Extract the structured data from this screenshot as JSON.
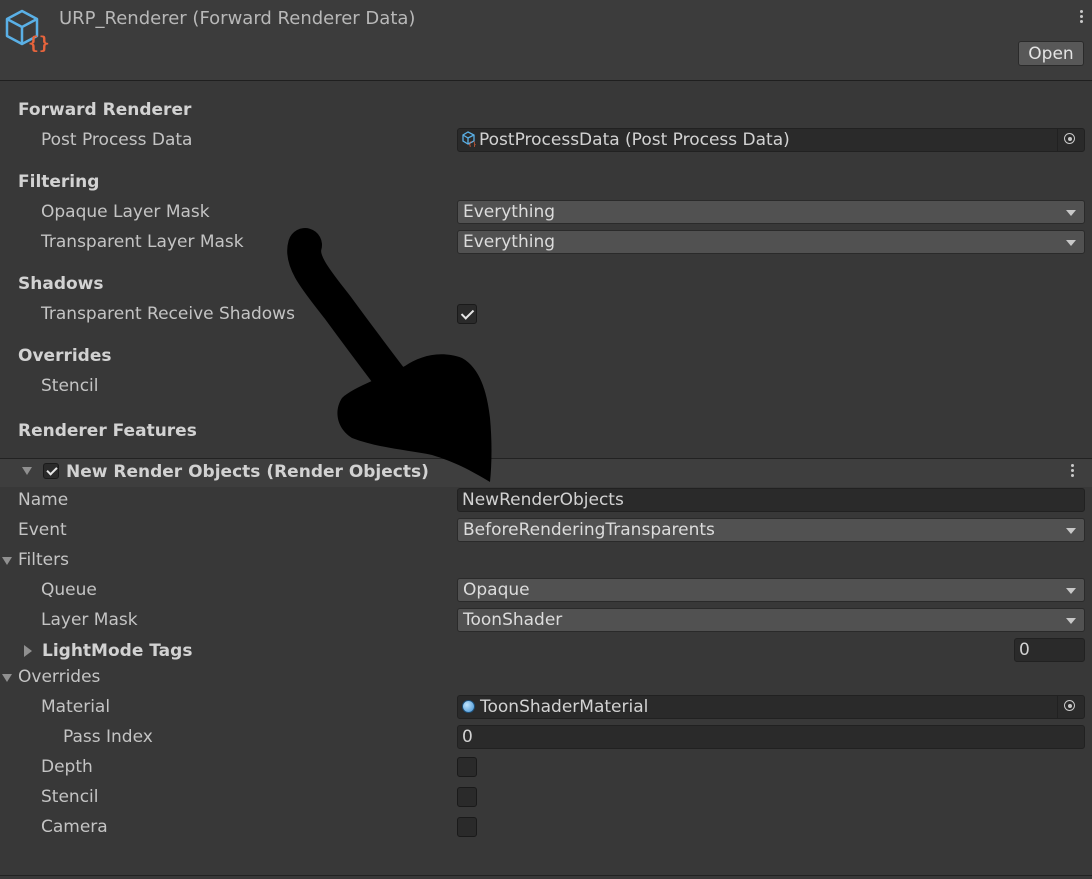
{
  "header": {
    "title": "URP_Renderer (Forward Renderer Data)",
    "open_label": "Open",
    "icon": "script-asset-icon"
  },
  "sections": {
    "forward_renderer": "Forward Renderer",
    "filtering": "Filtering",
    "shadows": "Shadows",
    "overrides": "Overrides",
    "renderer_features": "Renderer Features"
  },
  "fields": {
    "post_process_label": "Post Process Data",
    "post_process_value": "PostProcessData (Post Process Data)",
    "opaque_mask_label": "Opaque Layer Mask",
    "opaque_mask_value": "Everything",
    "transparent_mask_label": "Transparent Layer Mask",
    "transparent_mask_value": "Everything",
    "transparent_shadows_label": "Transparent Receive Shadows",
    "transparent_shadows_checked": true,
    "stencil_label": "Stencil"
  },
  "feature": {
    "title": "New Render Objects (Render Objects)",
    "enabled": true,
    "name_label": "Name",
    "name_value": "NewRenderObjects",
    "event_label": "Event",
    "event_value": "BeforeRenderingTransparents",
    "filters_label": "Filters",
    "queue_label": "Queue",
    "queue_value": "Opaque",
    "layer_mask_label": "Layer Mask",
    "layer_mask_value": "ToonShader",
    "lightmode_label": "LightMode Tags",
    "lightmode_count": "0",
    "overrides_label": "Overrides",
    "material_label": "Material",
    "material_value": "ToonShaderMaterial",
    "pass_index_label": "Pass Index",
    "pass_index_value": "0",
    "depth_label": "Depth",
    "depth_checked": false,
    "stencil_label": "Stencil",
    "stencil_checked": false,
    "camera_label": "Camera",
    "camera_checked": false
  },
  "colors": {
    "background": "#383838",
    "field": "#2a2a2a",
    "dropdown": "#515151",
    "annotation_arrow": "#000000"
  }
}
